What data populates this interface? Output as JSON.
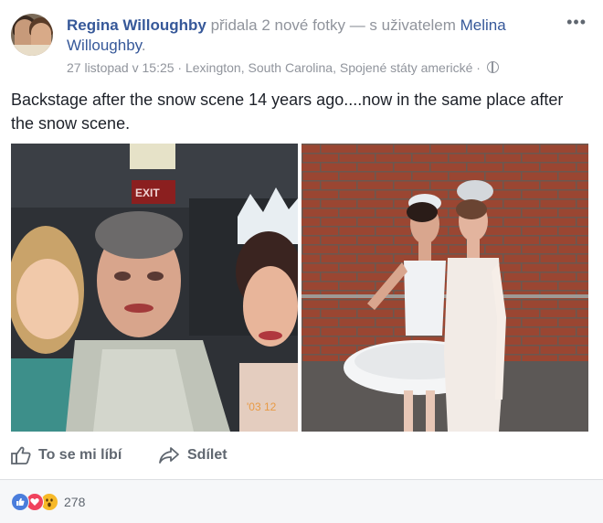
{
  "post": {
    "author": "Regina Willoughby",
    "action_text": " přidala 2 nové fotky — s uživatelem ",
    "tagged_user": "Melina Willoughby",
    "tagged_suffix": ".",
    "date": "27 listopad v 15:25",
    "separator": " · ",
    "location": "Lexington, South Carolina, Spojené státy americké",
    "privacy_icon": "globe-icon",
    "more_label": "•••",
    "caption": "Backstage after the snow scene 14 years ago....now in the same place after the snow scene.",
    "photos": [
      {
        "id": "photo-old",
        "stamp": "'03 12"
      },
      {
        "id": "photo-new"
      }
    ]
  },
  "actions": {
    "like_label": "To se mi líbí",
    "share_label": "Sdílet"
  },
  "reactions": {
    "icons": [
      "like-icon",
      "love-icon",
      "wow-icon"
    ],
    "count": "278"
  },
  "colors": {
    "link": "#365899",
    "meta": "#90949c",
    "text": "#1d2129",
    "action": "#606770",
    "like": "#4a7ddc",
    "love": "#f0425d",
    "wow": "#f7b928"
  }
}
